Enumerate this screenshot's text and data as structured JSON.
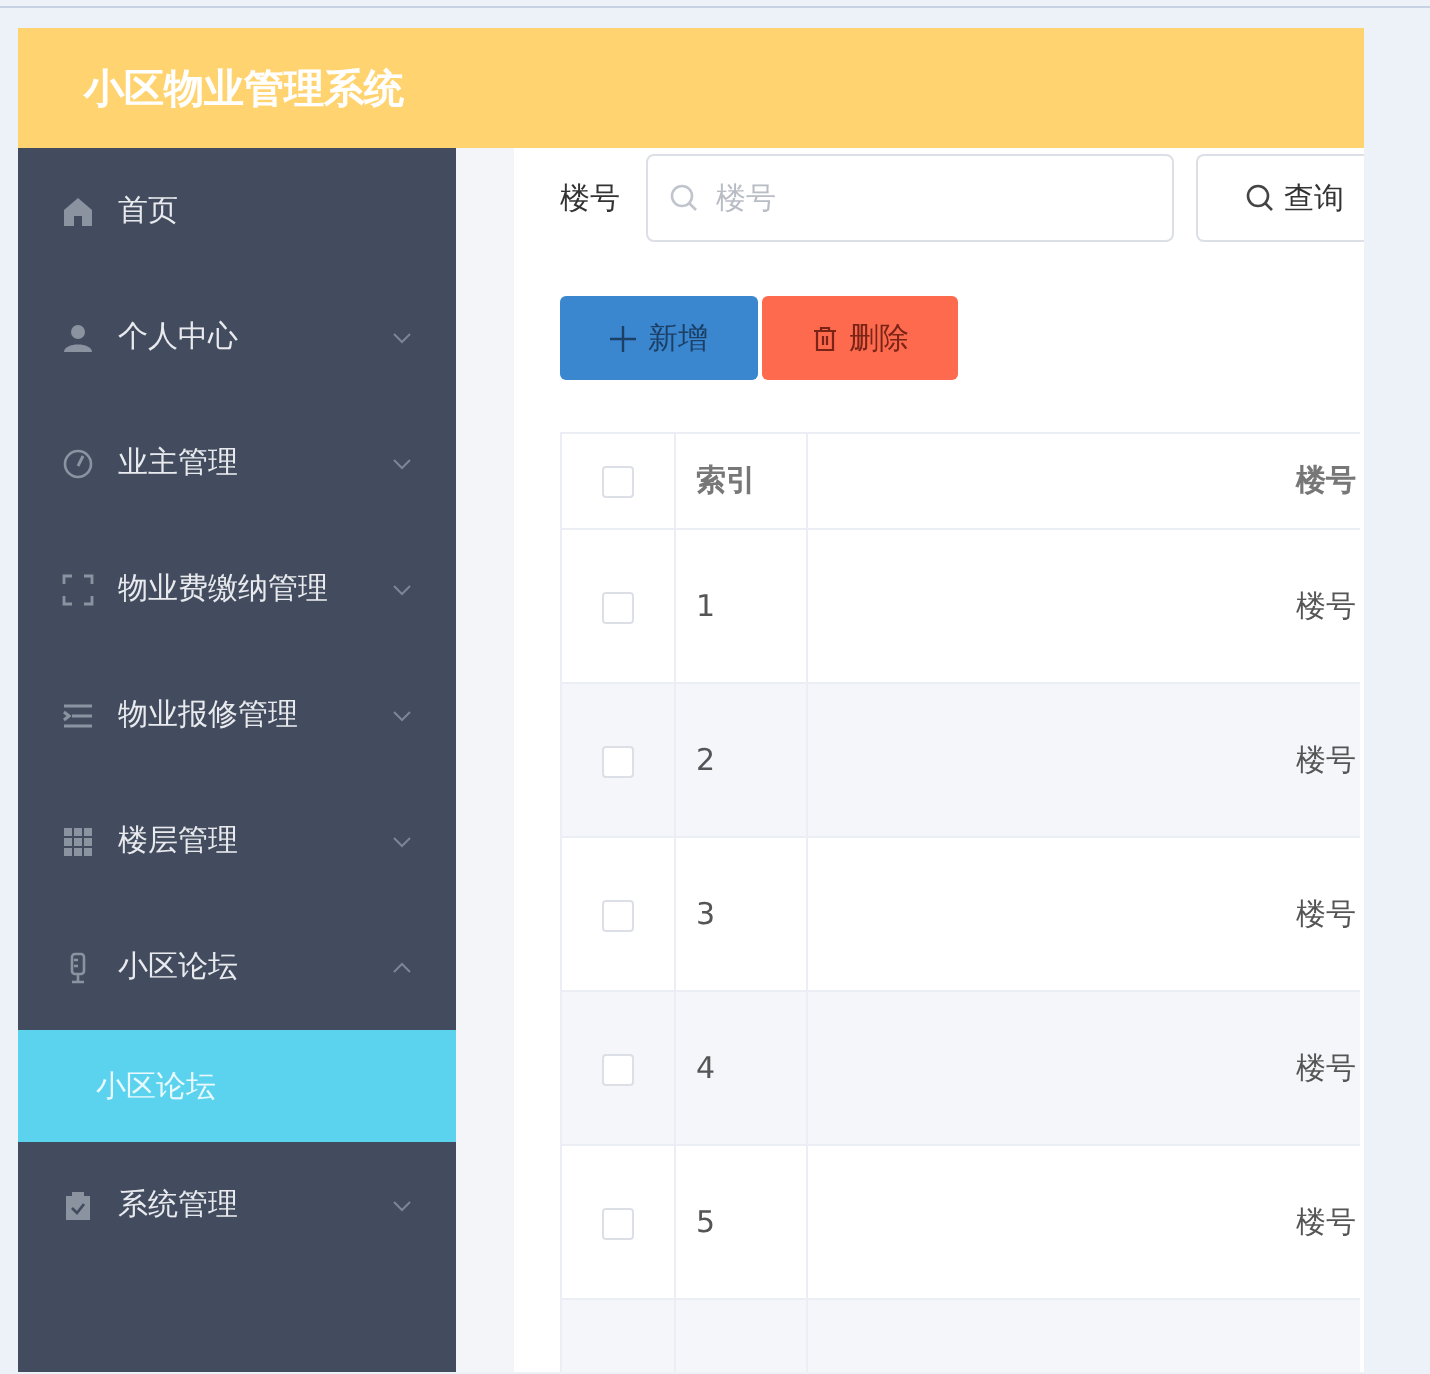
{
  "header": {
    "title": "小区物业管理系统"
  },
  "sidebar": {
    "items": [
      {
        "label": "首页",
        "kind": "link"
      },
      {
        "label": "个人中心",
        "kind": "submenu",
        "expanded": false
      },
      {
        "label": "业主管理",
        "kind": "submenu",
        "expanded": false
      },
      {
        "label": "物业费缴纳管理",
        "kind": "submenu",
        "expanded": false
      },
      {
        "label": "物业报修管理",
        "kind": "submenu",
        "expanded": false
      },
      {
        "label": "楼层管理",
        "kind": "submenu",
        "expanded": false
      },
      {
        "label": "小区论坛",
        "kind": "submenu",
        "expanded": true,
        "children": [
          {
            "label": "小区论坛",
            "selected": true
          }
        ]
      },
      {
        "label": "系统管理",
        "kind": "submenu",
        "expanded": false
      }
    ]
  },
  "search": {
    "label": "楼号",
    "placeholder": "楼号",
    "button": "查询"
  },
  "actions": [
    {
      "label": "新增",
      "kind": "add"
    },
    {
      "label": "删除",
      "kind": "delete"
    }
  ],
  "table": {
    "all_checked": false,
    "columns": [
      "索引",
      "楼号"
    ],
    "rows": [
      {
        "index": "1",
        "building": "楼号",
        "checked": false
      },
      {
        "index": "2",
        "building": "楼号",
        "checked": false
      },
      {
        "index": "3",
        "building": "楼号",
        "checked": false
      },
      {
        "index": "4",
        "building": "楼号",
        "checked": false
      },
      {
        "index": "5",
        "building": "楼号",
        "checked": false
      }
    ]
  }
}
